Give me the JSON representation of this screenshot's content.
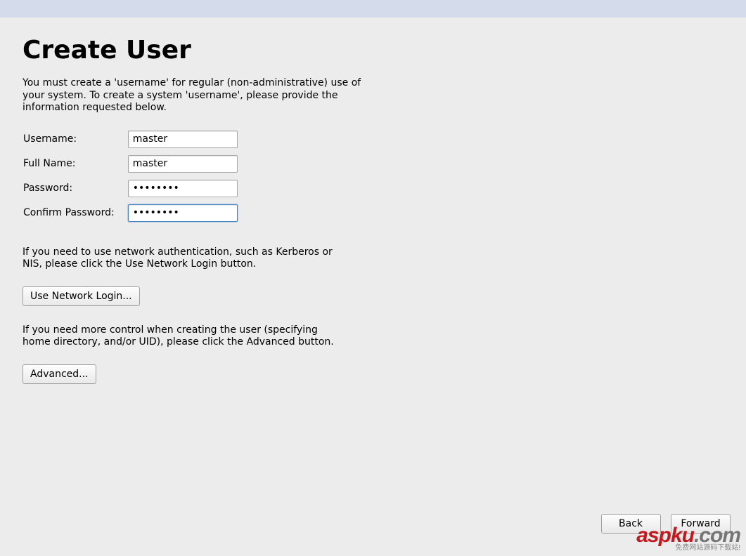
{
  "page": {
    "title": "Create User",
    "intro": "You must create a 'username' for regular (non-administrative) use of your system.  To create a system 'username', please provide the information requested below."
  },
  "form": {
    "username_label": "Username:",
    "username_value": "master",
    "fullname_label": "Full Name:",
    "fullname_value": "master",
    "password_label": "Password:",
    "password_value": "••••••••",
    "confirm_label": "Confirm Password:",
    "confirm_value": "••••••••"
  },
  "network": {
    "text": "If you need to use network authentication, such as Kerberos or NIS, please click the Use Network Login button.",
    "button": "Use Network Login..."
  },
  "advanced": {
    "text": "If you need more control when creating the user (specifying home directory, and/or UID), please click the Advanced button.",
    "button": "Advanced..."
  },
  "nav": {
    "back": "Back",
    "forward": "Forward"
  },
  "watermark": {
    "brand_red": "aspku",
    "brand_gray": ".com",
    "tagline": "免费网站源码下载站!"
  }
}
